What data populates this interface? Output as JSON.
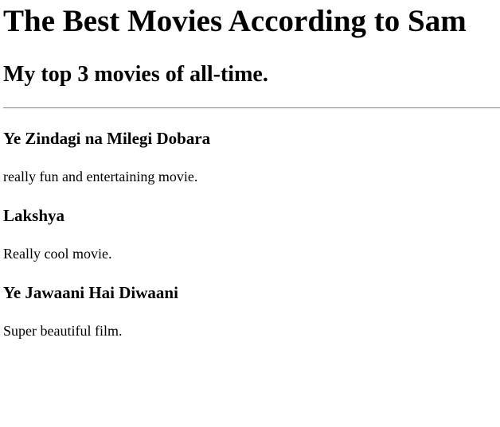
{
  "page": {
    "title": "The Best Movies According to Sam",
    "subtitle": "My top 3 movies of all-time."
  },
  "movies": [
    {
      "title": "Ye Zindagi na Milegi Dobara",
      "description": "really fun and entertaining movie."
    },
    {
      "title": "Lakshya",
      "description": "Really cool movie."
    },
    {
      "title": "Ye Jawaani Hai Diwaani",
      "description": "Super beautiful film."
    }
  ]
}
